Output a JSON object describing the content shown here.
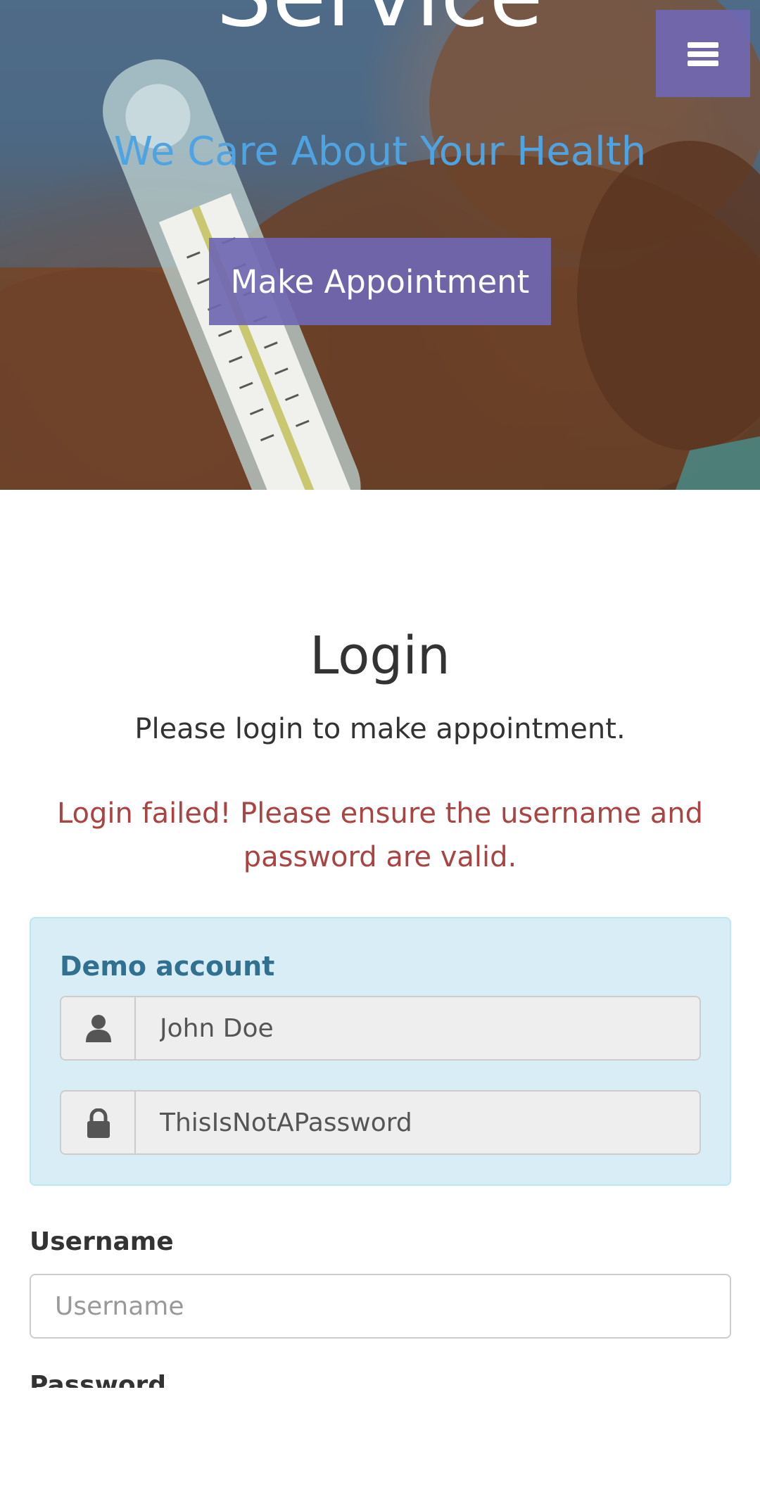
{
  "hero": {
    "title": "Service",
    "subtitle": "We Care About Your Health",
    "appointment_button": "Make Appointment",
    "menu_icon": "hamburger-menu-icon"
  },
  "login": {
    "title": "Login",
    "subtitle": "Please login to make appointment.",
    "error": "Login failed! Please ensure the username and password are valid."
  },
  "demo": {
    "heading": "Demo account",
    "username_value": "John Doe",
    "password_value": "ThisIsNotAPassword",
    "username_icon": "user-icon",
    "password_icon": "lock-icon"
  },
  "form": {
    "username_label": "Username",
    "username_placeholder": "Username",
    "password_label": "Password"
  },
  "colors": {
    "accent_purple": "#7067b2",
    "subtitle_blue": "#4ea4e3",
    "error_red": "#a94442",
    "info_bg": "#d9edf7",
    "info_text": "#31708f"
  }
}
